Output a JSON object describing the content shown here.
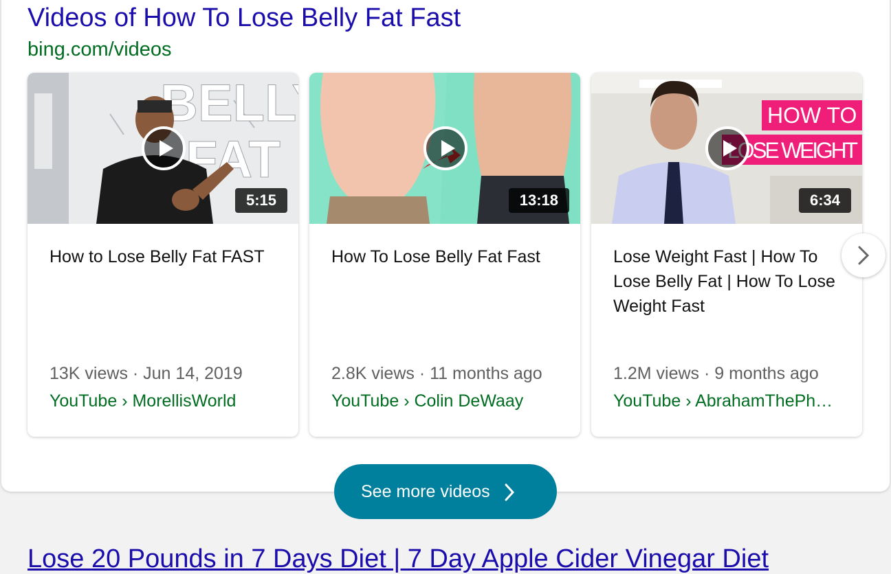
{
  "section": {
    "title": "Videos of How To Lose Belly Fat Fast",
    "source": "bing.com/videos"
  },
  "videos": [
    {
      "title": "How to Lose Belly Fat FAST",
      "duration": "5:15",
      "meta": "13K views · Jun 14, 2019",
      "channel": "YouTube › MorellisWorld",
      "thumb_text_1": "BELLY",
      "thumb_text_2": "FAT"
    },
    {
      "title": "How To Lose Belly Fat Fast",
      "duration": "13:18",
      "meta": "2.8K views · 11 months ago",
      "channel": "YouTube › Colin DeWaay"
    },
    {
      "title": "Lose Weight Fast | How To Lose Belly Fat | How To Lose Weight Fast",
      "duration": "6:34",
      "meta": "1.2M views · 9 months ago",
      "channel": "YouTube › AbrahamThePh…",
      "thumb_text_1": "HOW TO",
      "thumb_text_2": "LOSE WEIGHT"
    }
  ],
  "see_more": {
    "label": "See more videos"
  },
  "next_result": {
    "title": "Lose 20 Pounds in 7 Days Diet | 7 Day Apple Cider Vinegar Diet"
  },
  "icons": {
    "play": "play-icon",
    "next": "chevron-right-icon",
    "see_more": "chevron-right-icon"
  },
  "colors": {
    "link": "#1a0dab",
    "source_green": "#006d21",
    "button": "#00809d"
  }
}
